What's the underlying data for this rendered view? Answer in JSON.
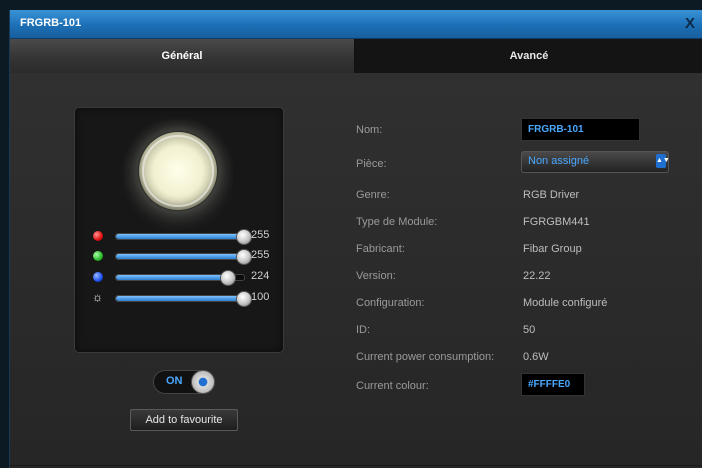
{
  "window": {
    "title": "FRGRB-101",
    "close_label": "X"
  },
  "tabs": [
    {
      "label": "Général",
      "active": true
    },
    {
      "label": "Avancé",
      "active": false
    }
  ],
  "light": {
    "bulb_color": "#FFFFE0"
  },
  "sliders": [
    {
      "name": "red",
      "color": "#ff2020",
      "value": "255",
      "fraction": 1.0
    },
    {
      "name": "green",
      "color": "#35c235",
      "value": "255",
      "fraction": 1.0
    },
    {
      "name": "blue",
      "color": "#2060ff",
      "value": "224",
      "fraction": 0.878
    },
    {
      "name": "brightness",
      "icon": "sun-icon",
      "value": "100",
      "fraction": 1.0
    }
  ],
  "toggle": {
    "label": "ON",
    "state": true
  },
  "favourite_button": "Add to favourite",
  "properties": {
    "nom_label": "Nom:",
    "nom_value": "FRGRB-101",
    "piece_label": "Pièce:",
    "piece_value": "Non assigné",
    "genre_label": "Genre:",
    "genre_value": "RGB Driver",
    "type_label": "Type de Module:",
    "type_value": "FGRGBM441",
    "fabricant_label": "Fabricant:",
    "fabricant_value": "Fibar Group",
    "version_label": "Version:",
    "version_value": "22.22",
    "config_label": "Configuration:",
    "config_value": "Module configuré",
    "id_label": "ID:",
    "id_value": "50",
    "power_label": "Current power consumption:",
    "power_value": "0.6W",
    "colour_label": "Current colour:",
    "colour_value": "#FFFFE0"
  },
  "colors": {
    "accent": "#1d6fb5",
    "value_blue": "#4aa8ff"
  }
}
